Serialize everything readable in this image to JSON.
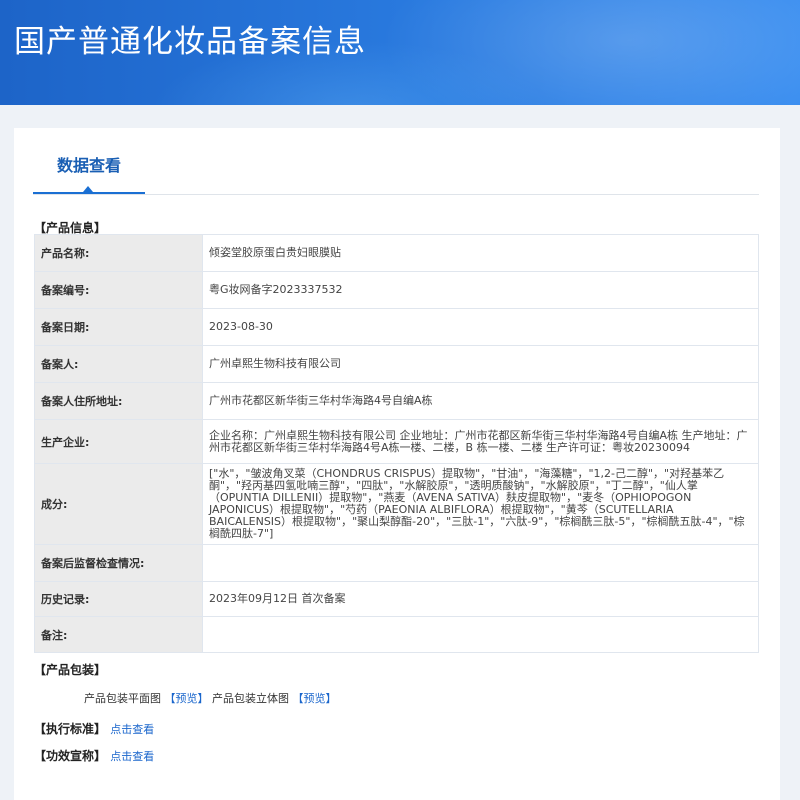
{
  "header": {
    "title": "国产普通化妆品备案信息"
  },
  "tab": {
    "label": "数据查看"
  },
  "product_info": {
    "section_title": "【产品信息】",
    "rows": [
      {
        "label": "产品名称:",
        "value": "倾姿堂胶原蛋白贵妇眼膜贴"
      },
      {
        "label": "备案编号:",
        "value": "粤G妆网备字2023337532"
      },
      {
        "label": "备案日期:",
        "value": "2023-08-30"
      },
      {
        "label": "备案人:",
        "value": "广州卓熙生物科技有限公司"
      },
      {
        "label": "备案人住所地址:",
        "value": "广州市花都区新华街三华村华海路4号自编A栋"
      },
      {
        "label": "生产企业:",
        "value": "企业名称：广州卓熙生物科技有限公司 企业地址：广州市花都区新华街三华村华海路4号自编A栋 生产地址：广州市花都区新华街三华村华海路4号A栋一楼、二楼，B 栋一楼、二楼 生产许可证：粤妆20230094"
      },
      {
        "label": "成分:",
        "value": "[\"水\"，\"皱波角叉菜（CHONDRUS CRISPUS）提取物\"，\"甘油\"，\"海藻糖\"，\"1,2-己二醇\"，\"对羟基苯乙酮\"，\"羟丙基四氢吡喃三醇\"，\"四肽\"，\"水解胶原\"，\"透明质酸钠\"，\"水解胶原\"，\"丁二醇\"，\"仙人掌（OPUNTIA DILLENII）提取物\"，\"燕麦（AVENA SATIVA）麸皮提取物\"，\"麦冬（OPHIOPOGON JAPONICUS）根提取物\"，\"芍药（PAEONIA ALBIFLORA）根提取物\"，\"黄芩（SCUTELLARIA BAICALENSIS）根提取物\"，\"聚山梨醇酯-20\"，\"三肽-1\"，\"六肽-9\"，\"棕榈酰三肽-5\"，\"棕榈酰五肽-4\"，\"棕榈酰四肽-7\"]"
      },
      {
        "label": "备案后监督检查情况:",
        "value": ""
      },
      {
        "label": "历史记录:",
        "value": "2023年09月12日 首次备案"
      },
      {
        "label": "备注:",
        "value": ""
      }
    ]
  },
  "packaging": {
    "section_title": "【产品包装】",
    "flat_label": "产品包装平面图",
    "flat_link": "【预览】",
    "solid_label": "产品包装立体图",
    "solid_link": "【预览】"
  },
  "standard": {
    "label": "【执行标准】",
    "link": "点击查看"
  },
  "efficacy": {
    "label": "【功效宣称】",
    "link": "点击查看"
  }
}
